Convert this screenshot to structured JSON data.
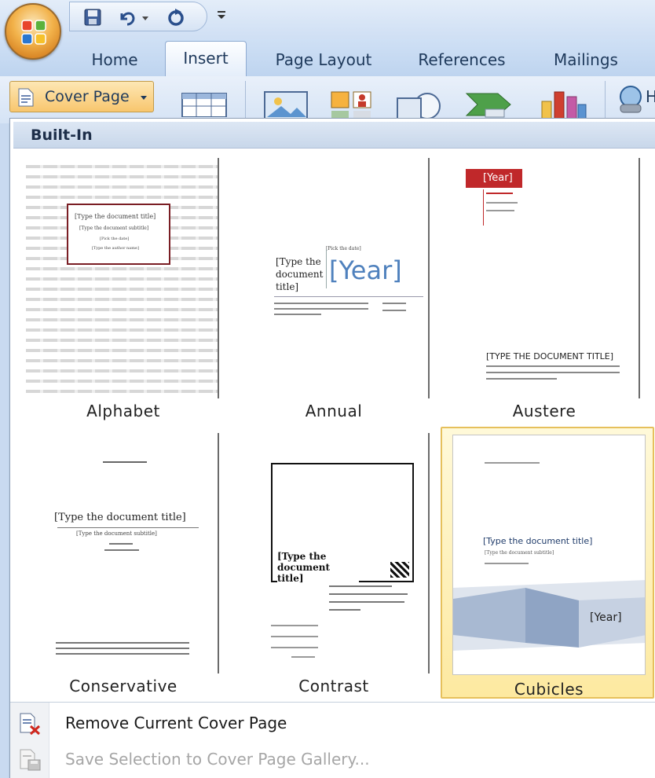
{
  "tabs": [
    {
      "label": "Home"
    },
    {
      "label": "Insert"
    },
    {
      "label": "Page Layout"
    },
    {
      "label": "References"
    },
    {
      "label": "Mailings"
    }
  ],
  "ribbon": {
    "cover_page_label": "Cover Page",
    "truncated_label": "H"
  },
  "dropdown": {
    "section_title": "Built-In",
    "gallery": [
      {
        "caption": "Alphabet",
        "box_title": "[Type the document title]",
        "box_subtitle": "[Type the document subtitle]",
        "box_author": "[Pick the date]",
        "box_line": "[Type the author name]"
      },
      {
        "caption": "Annual",
        "title": "[Type the document title]",
        "date": "[Pick the date]",
        "year": "[Year]"
      },
      {
        "caption": "Austere",
        "year": "[Year]",
        "title": "[TYPE THE DOCUMENT TITLE]"
      },
      {
        "caption": "Conservative",
        "title": "[Type the document title]",
        "subtitle": "[Type the document subtitle]"
      },
      {
        "caption": "Contrast",
        "title": "[Type the document title]"
      },
      {
        "caption": "Cubicles",
        "title": "[Type the document title]",
        "subtitle": "[Type the document subtitle]",
        "year": "[Year]"
      }
    ],
    "selected_index": 5,
    "menu": [
      {
        "label": "Remove Current Cover Page",
        "enabled": true
      },
      {
        "label": "Save Selection to Cover Page Gallery...",
        "enabled": false
      }
    ]
  },
  "colors": {
    "accent_blue": "#4f81bd",
    "austere_red": "#c0282a",
    "selection_gold": "#e6c05c"
  }
}
